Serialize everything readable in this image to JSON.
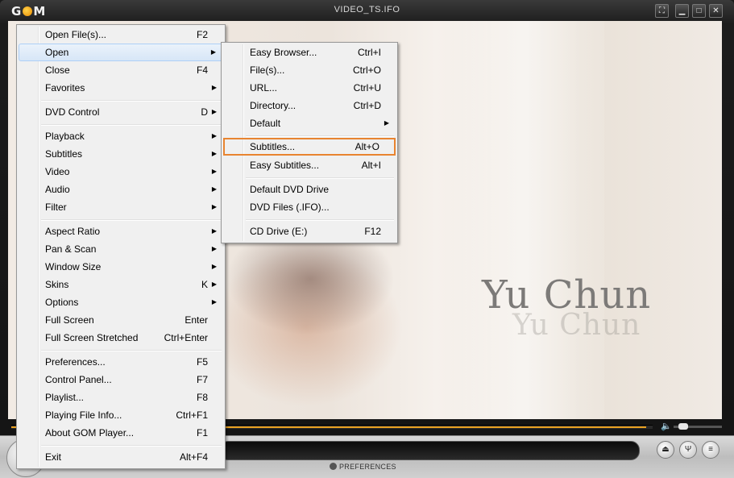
{
  "window": {
    "title": "VIDEO_TS.IFO",
    "logo": "GOM"
  },
  "video": {
    "caption": "Yu Chun",
    "caption_ghost": "Yu Chun"
  },
  "main_menu": {
    "items": [
      {
        "label": "Open File(s)...",
        "key": "F2"
      },
      {
        "label": "Open",
        "key": "",
        "submenu": true
      },
      {
        "label": "Close",
        "key": "F4"
      },
      {
        "label": "Favorites",
        "key": "",
        "submenu": true
      },
      {
        "label": "DVD Control",
        "key": "D",
        "submenu": true
      },
      {
        "label": "Playback",
        "key": "",
        "submenu": true
      },
      {
        "label": "Subtitles",
        "key": "",
        "submenu": true
      },
      {
        "label": "Video",
        "key": "",
        "submenu": true
      },
      {
        "label": "Audio",
        "key": "",
        "submenu": true
      },
      {
        "label": "Filter",
        "key": "",
        "submenu": true
      },
      {
        "label": "Aspect Ratio",
        "key": "",
        "submenu": true
      },
      {
        "label": "Pan & Scan",
        "key": "",
        "submenu": true
      },
      {
        "label": "Window Size",
        "key": "",
        "submenu": true
      },
      {
        "label": "Skins",
        "key": "K",
        "submenu": true
      },
      {
        "label": "Options",
        "key": "",
        "submenu": true
      },
      {
        "label": "Full Screen",
        "key": "Enter"
      },
      {
        "label": "Full Screen Stretched",
        "key": "Ctrl+Enter"
      },
      {
        "label": "Preferences...",
        "key": "F5"
      },
      {
        "label": "Control Panel...",
        "key": "F7"
      },
      {
        "label": "Playlist...",
        "key": "F8"
      },
      {
        "label": "Playing File Info...",
        "key": "Ctrl+F1"
      },
      {
        "label": "About GOM Player...",
        "key": "F1"
      },
      {
        "label": "Exit",
        "key": "Alt+F4"
      }
    ]
  },
  "open_submenu": {
    "items": [
      {
        "label": "Easy Browser...",
        "key": "Ctrl+I"
      },
      {
        "label": "File(s)...",
        "key": "Ctrl+O"
      },
      {
        "label": "URL...",
        "key": "Ctrl+U"
      },
      {
        "label": "Directory...",
        "key": "Ctrl+D"
      },
      {
        "label": "Default",
        "key": "",
        "submenu": true
      },
      {
        "label": "Subtitles...",
        "key": "Alt+O"
      },
      {
        "label": "Easy Subtitles...",
        "key": "Alt+I"
      },
      {
        "label": "Default DVD Drive",
        "key": ""
      },
      {
        "label": "DVD Files (.IFO)...",
        "key": ""
      },
      {
        "label": "CD Drive (E:)",
        "key": "F12"
      }
    ]
  },
  "controls": {
    "preferences_label": "PREFERENCES",
    "seek_progress": 0.99,
    "volume_level": 0.1
  },
  "colors": {
    "accent": "#e8a020",
    "highlight_box": "#e88430"
  }
}
